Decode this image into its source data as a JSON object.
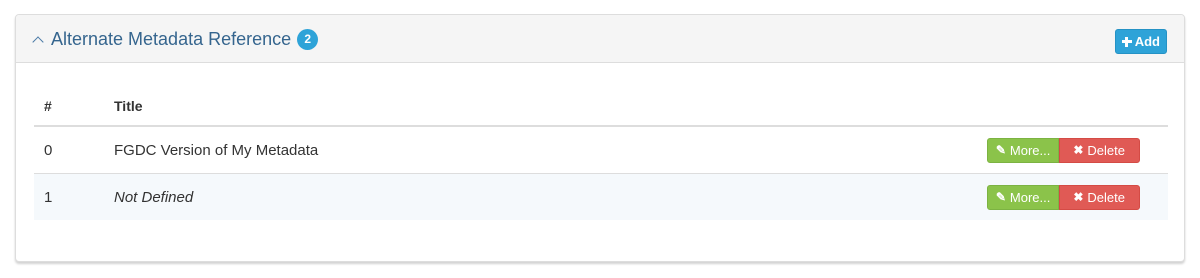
{
  "panel": {
    "title": "Alternate Metadata Reference",
    "badge_count": "2",
    "add_label": "Add"
  },
  "table": {
    "headers": [
      "#",
      "Title"
    ],
    "rows": [
      {
        "index": "0",
        "title": "FGDC Version of My Metadata",
        "more_label": "More...",
        "delete_label": "Delete"
      },
      {
        "index": "1",
        "title": "Not Defined",
        "more_label": "More...",
        "delete_label": "Delete"
      }
    ]
  },
  "icons": {
    "collapse": "chevron-up-icon",
    "add": "plus-icon",
    "more": "pencil-icon",
    "delete": "x-icon"
  },
  "colors": {
    "title": "#35658e",
    "badge": "#2ea3d8",
    "add_button": "#2ea3d8",
    "more_button": "#8bc34a",
    "delete_button": "#e05a55"
  }
}
